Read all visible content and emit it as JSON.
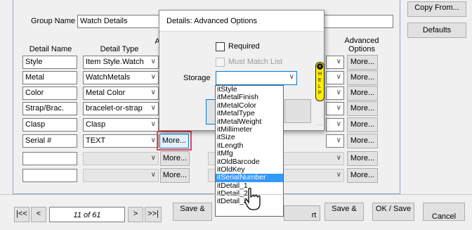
{
  "top_buttons": {
    "copy_from": "Copy From...",
    "defaults": "Defaults"
  },
  "group": {
    "label": "Group Name",
    "value": "Watch Details"
  },
  "columns": {
    "detail_name": "Detail Name",
    "detail_type": "Detail Type",
    "a_partial": "A",
    "advanced_options_line1": "Advanced",
    "advanced_options_line2": "Options"
  },
  "rows": [
    {
      "name": "Style",
      "type": "Item Style.Watch"
    },
    {
      "name": "Metal",
      "type": "WatchMetals"
    },
    {
      "name": "Color",
      "type": "Metal Color"
    },
    {
      "name": "Strap/Brac.",
      "type": "bracelet-or-strap"
    },
    {
      "name": "Clasp",
      "type": "Clasp"
    },
    {
      "name": "Serial #",
      "type": "TEXT"
    },
    {
      "name": "",
      "type": ""
    },
    {
      "name": "",
      "type": ""
    }
  ],
  "more_label": "More...",
  "dialog": {
    "title": "Details: Advanced Options",
    "required_label": "Required",
    "must_match_label": "Must Match List",
    "storage_label": "Storage",
    "storage_value": ""
  },
  "help_tab": {
    "icon": "close-icon",
    "letters": [
      "H",
      "E",
      "L",
      "P"
    ]
  },
  "storage_options": [
    "itStyle",
    "itMetalFinish",
    "itMetalColor",
    "itMetalType",
    "itMetalWeight",
    "itMillimeter",
    "itSize",
    "itLength",
    "itMfg",
    "itOldBarcode",
    "itOldKey",
    "itSerialNumber",
    "itDetail_1",
    "itDetail_2",
    "itDetail_3"
  ],
  "storage_selected_index": 11,
  "bottom": {
    "first": "|<<",
    "prev": "<",
    "page": "11 of 61",
    "next": ">",
    "last": ">>|",
    "save1": "Save &",
    "save2": "Save &",
    "ok_save": "OK / Save",
    "cancel": "Cancel",
    "partial_text": "rt"
  },
  "colors": {
    "highlight": "#3399ff",
    "annotation": "#e8474c",
    "help_tab": "#ffee00",
    "selected_row": "#3399ff"
  }
}
